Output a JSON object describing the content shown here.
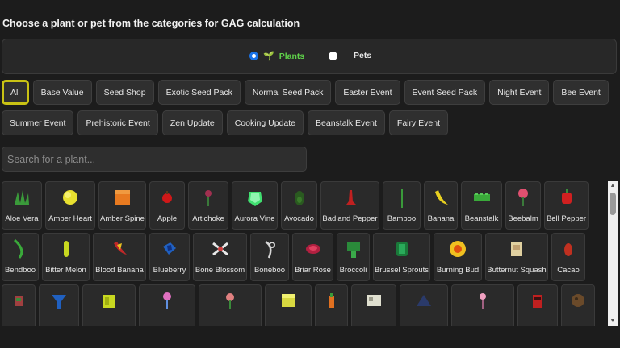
{
  "heading": "Choose a plant or pet from the categories for GAG calculation",
  "type_options": [
    {
      "label": "Plants",
      "icon": "sprout-icon",
      "checked": true
    },
    {
      "label": "Pets",
      "icon": "paw-icon",
      "checked": false
    }
  ],
  "categories_row1": [
    "All",
    "Base Value",
    "Seed Shop",
    "Exotic Seed Pack",
    "Normal Seed Pack",
    "Easter Event",
    "Event Seed Pack",
    "Night Event",
    "Bee Event"
  ],
  "categories_row2": [
    "Summer Event",
    "Prehistoric Event",
    "Zen Update",
    "Cooking Update",
    "Beanstalk Event",
    "Fairy Event"
  ],
  "active_category": "All",
  "search": {
    "placeholder": "Search for a plant..."
  },
  "plants_row1": [
    "Aloe Vera",
    "Amber Heart",
    "Amber Spine",
    "Apple",
    "Artichoke",
    "Aurora Vine",
    "Avocado",
    "Badland Pepper",
    "Bamboo",
    "Banana",
    "Beanstalk",
    "Beebalm",
    "Bell Pepper"
  ],
  "plants_row2": [
    "Bendboo",
    "Bitter Melon",
    "Blood Banana",
    "Blueberry",
    "Bone Blossom",
    "Boneboo",
    "Briar Rose",
    "Broccoli",
    "Brussel Sprouts",
    "Burning Bud",
    "Butternut Squash",
    "Cacao"
  ],
  "colors": {
    "accent": "#5fd14a",
    "active_border": "#c9c214",
    "radio": "#1a73e8"
  }
}
